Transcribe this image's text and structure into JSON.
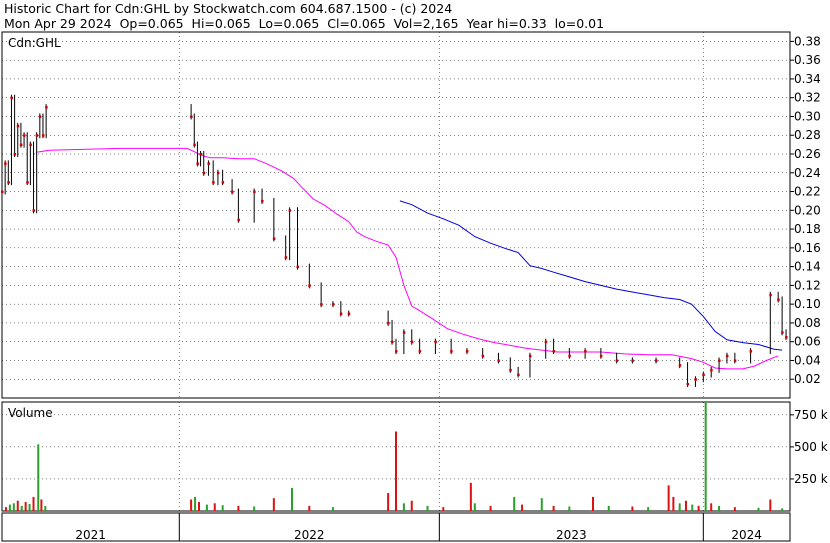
{
  "header": {
    "line1": "Historic Chart for Cdn:GHL by Stockwatch.com 604.687.1500 - (c) 2024",
    "line2": "Mon Apr 29 2024  Op=0.065  Hi=0.065  Lo=0.065  Cl=0.065  Vol=2,165  Year hi=0.33  lo=0.01"
  },
  "chart_data": [
    {
      "type": "line",
      "title": "Cdn:GHL",
      "ylim": [
        0.0,
        0.39
      ],
      "ytick_labels": [
        "0.38",
        "0.36",
        "0.34",
        "0.32",
        "0.30",
        "0.28",
        "0.26",
        "0.24",
        "0.22",
        "0.20",
        "0.18",
        "0.16",
        "0.14",
        "0.12",
        "0.10",
        "0.08",
        "0.06",
        "0.04",
        "0.02"
      ],
      "yticks": [
        0.38,
        0.36,
        0.34,
        0.32,
        0.3,
        0.28,
        0.26,
        0.24,
        0.22,
        0.2,
        0.18,
        0.16,
        0.14,
        0.12,
        0.1,
        0.08,
        0.06,
        0.04,
        0.02
      ],
      "x_period_labels": [
        "2021",
        "2022",
        "2023",
        "2024"
      ],
      "x_period_bounds": [
        [
          0.0,
          0.225
        ],
        [
          0.225,
          0.555
        ],
        [
          0.555,
          0.89
        ],
        [
          0.89,
          1.0
        ]
      ],
      "grid": true,
      "colors": {
        "price": "#000000",
        "close_dot": "#cc0000",
        "ma_short": "#ff00ff",
        "ma_long": "#0000dd"
      },
      "series": [
        {
          "kind": "ma_short",
          "points": [
            [
              0.045,
              0.262
            ],
            [
              0.06,
              0.264
            ],
            [
              0.15,
              0.266
            ],
            [
              0.235,
              0.266
            ],
            [
              0.245,
              0.262
            ],
            [
              0.255,
              0.258
            ],
            [
              0.265,
              0.256
            ],
            [
              0.28,
              0.256
            ],
            [
              0.3,
              0.255
            ],
            [
              0.32,
              0.255
            ],
            [
              0.335,
              0.25
            ],
            [
              0.355,
              0.242
            ],
            [
              0.37,
              0.234
            ],
            [
              0.38,
              0.225
            ],
            [
              0.395,
              0.212
            ],
            [
              0.41,
              0.205
            ],
            [
              0.425,
              0.196
            ],
            [
              0.44,
              0.188
            ],
            [
              0.45,
              0.177
            ],
            [
              0.46,
              0.172
            ],
            [
              0.475,
              0.167
            ],
            [
              0.49,
              0.163
            ],
            [
              0.5,
              0.15
            ],
            [
              0.51,
              0.12
            ],
            [
              0.52,
              0.098
            ],
            [
              0.53,
              0.093
            ],
            [
              0.545,
              0.085
            ],
            [
              0.565,
              0.074
            ],
            [
              0.585,
              0.068
            ],
            [
              0.605,
              0.063
            ],
            [
              0.625,
              0.059
            ],
            [
              0.645,
              0.056
            ],
            [
              0.665,
              0.053
            ],
            [
              0.685,
              0.051
            ],
            [
              0.705,
              0.049
            ],
            [
              0.73,
              0.049
            ],
            [
              0.76,
              0.049
            ],
            [
              0.79,
              0.047
            ],
            [
              0.82,
              0.046
            ],
            [
              0.85,
              0.046
            ],
            [
              0.875,
              0.042
            ],
            [
              0.89,
              0.038
            ],
            [
              0.905,
              0.032
            ],
            [
              0.92,
              0.031
            ],
            [
              0.94,
              0.031
            ],
            [
              0.955,
              0.034
            ],
            [
              0.97,
              0.04
            ],
            [
              0.985,
              0.045
            ]
          ]
        },
        {
          "kind": "ma_long",
          "points": [
            [
              0.505,
              0.21
            ],
            [
              0.52,
              0.206
            ],
            [
              0.54,
              0.197
            ],
            [
              0.56,
              0.191
            ],
            [
              0.58,
              0.184
            ],
            [
              0.6,
              0.172
            ],
            [
              0.62,
              0.165
            ],
            [
              0.64,
              0.159
            ],
            [
              0.655,
              0.155
            ],
            [
              0.67,
              0.141
            ],
            [
              0.685,
              0.138
            ],
            [
              0.7,
              0.134
            ],
            [
              0.72,
              0.129
            ],
            [
              0.74,
              0.124
            ],
            [
              0.76,
              0.12
            ],
            [
              0.78,
              0.116
            ],
            [
              0.8,
              0.113
            ],
            [
              0.82,
              0.11
            ],
            [
              0.84,
              0.107
            ],
            [
              0.86,
              0.105
            ],
            [
              0.875,
              0.1
            ],
            [
              0.89,
              0.087
            ],
            [
              0.905,
              0.071
            ],
            [
              0.92,
              0.062
            ],
            [
              0.94,
              0.059
            ],
            [
              0.96,
              0.057
            ],
            [
              0.98,
              0.052
            ],
            [
              0.99,
              0.051
            ]
          ]
        },
        {
          "kind": "price",
          "points": [
            [
              0.0,
              0.22
            ],
            [
              0.004,
              0.25
            ],
            [
              0.008,
              0.23
            ],
            [
              0.012,
              0.32
            ],
            [
              0.016,
              0.26
            ],
            [
              0.02,
              0.29
            ],
            [
              0.024,
              0.27
            ],
            [
              0.028,
              0.28
            ],
            [
              0.032,
              0.23
            ],
            [
              0.036,
              0.27
            ],
            [
              0.04,
              0.2
            ],
            [
              0.044,
              0.28
            ],
            [
              0.048,
              0.3
            ],
            [
              0.052,
              0.28
            ],
            [
              0.056,
              0.31
            ],
            [
              0.24,
              0.3
            ],
            [
              0.244,
              0.27
            ],
            [
              0.248,
              0.25
            ],
            [
              0.252,
              0.26
            ],
            [
              0.256,
              0.24
            ],
            [
              0.262,
              0.25
            ],
            [
              0.268,
              0.23
            ],
            [
              0.274,
              0.24
            ],
            [
              0.28,
              0.23
            ],
            [
              0.292,
              0.22
            ],
            [
              0.3,
              0.19
            ],
            [
              0.32,
              0.22
            ],
            [
              0.33,
              0.21
            ],
            [
              0.345,
              0.17
            ],
            [
              0.36,
              0.15
            ],
            [
              0.365,
              0.2
            ],
            [
              0.375,
              0.14
            ],
            [
              0.39,
              0.12
            ],
            [
              0.405,
              0.1
            ],
            [
              0.42,
              0.1
            ],
            [
              0.43,
              0.09
            ],
            [
              0.44,
              0.09
            ],
            [
              0.49,
              0.08
            ],
            [
              0.495,
              0.06
            ],
            [
              0.5,
              0.05
            ],
            [
              0.51,
              0.07
            ],
            [
              0.52,
              0.06
            ],
            [
              0.53,
              0.05
            ],
            [
              0.55,
              0.06
            ],
            [
              0.57,
              0.05
            ],
            [
              0.59,
              0.05
            ],
            [
              0.61,
              0.045
            ],
            [
              0.63,
              0.04
            ],
            [
              0.645,
              0.03
            ],
            [
              0.655,
              0.025
            ],
            [
              0.67,
              0.045
            ],
            [
              0.69,
              0.06
            ],
            [
              0.7,
              0.05
            ],
            [
              0.72,
              0.045
            ],
            [
              0.74,
              0.05
            ],
            [
              0.76,
              0.045
            ],
            [
              0.78,
              0.04
            ],
            [
              0.8,
              0.04
            ],
            [
              0.83,
              0.04
            ],
            [
              0.86,
              0.035
            ],
            [
              0.87,
              0.015
            ],
            [
              0.88,
              0.02
            ],
            [
              0.89,
              0.025
            ],
            [
              0.9,
              0.03
            ],
            [
              0.91,
              0.04
            ],
            [
              0.92,
              0.045
            ],
            [
              0.93,
              0.04
            ],
            [
              0.95,
              0.05
            ],
            [
              0.975,
              0.11
            ],
            [
              0.985,
              0.105
            ],
            [
              0.99,
              0.07
            ],
            [
              0.995,
              0.065
            ]
          ]
        }
      ]
    },
    {
      "type": "bar",
      "title": "Volume",
      "ylim": [
        0,
        850000
      ],
      "ytick_labels": [
        "750 k",
        "500 k",
        "250 k"
      ],
      "yticks": [
        750000,
        500000,
        250000
      ],
      "colors": {
        "up": "#2aa02a",
        "down": "#dd1111"
      },
      "bars": [
        {
          "x": 0.005,
          "v": 30000,
          "c": "down"
        },
        {
          "x": 0.01,
          "v": 50000,
          "c": "up"
        },
        {
          "x": 0.015,
          "v": 60000,
          "c": "up"
        },
        {
          "x": 0.02,
          "v": 80000,
          "c": "down"
        },
        {
          "x": 0.025,
          "v": 40000,
          "c": "up"
        },
        {
          "x": 0.03,
          "v": 70000,
          "c": "down"
        },
        {
          "x": 0.035,
          "v": 55000,
          "c": "up"
        },
        {
          "x": 0.04,
          "v": 110000,
          "c": "down"
        },
        {
          "x": 0.046,
          "v": 520000,
          "c": "up"
        },
        {
          "x": 0.05,
          "v": 90000,
          "c": "down"
        },
        {
          "x": 0.055,
          "v": 40000,
          "c": "up"
        },
        {
          "x": 0.24,
          "v": 90000,
          "c": "down"
        },
        {
          "x": 0.245,
          "v": 110000,
          "c": "up"
        },
        {
          "x": 0.25,
          "v": 70000,
          "c": "down"
        },
        {
          "x": 0.26,
          "v": 50000,
          "c": "up"
        },
        {
          "x": 0.27,
          "v": 60000,
          "c": "down"
        },
        {
          "x": 0.28,
          "v": 45000,
          "c": "up"
        },
        {
          "x": 0.3,
          "v": 40000,
          "c": "down"
        },
        {
          "x": 0.32,
          "v": 35000,
          "c": "up"
        },
        {
          "x": 0.345,
          "v": 100000,
          "c": "down"
        },
        {
          "x": 0.368,
          "v": 180000,
          "c": "up"
        },
        {
          "x": 0.39,
          "v": 40000,
          "c": "down"
        },
        {
          "x": 0.42,
          "v": 30000,
          "c": "up"
        },
        {
          "x": 0.49,
          "v": 140000,
          "c": "down"
        },
        {
          "x": 0.5,
          "v": 620000,
          "c": "down"
        },
        {
          "x": 0.51,
          "v": 60000,
          "c": "up"
        },
        {
          "x": 0.52,
          "v": 80000,
          "c": "down"
        },
        {
          "x": 0.54,
          "v": 40000,
          "c": "up"
        },
        {
          "x": 0.56,
          "v": 30000,
          "c": "down"
        },
        {
          "x": 0.595,
          "v": 220000,
          "c": "down"
        },
        {
          "x": 0.6,
          "v": 60000,
          "c": "up"
        },
        {
          "x": 0.62,
          "v": 40000,
          "c": "down"
        },
        {
          "x": 0.65,
          "v": 110000,
          "c": "up"
        },
        {
          "x": 0.66,
          "v": 50000,
          "c": "down"
        },
        {
          "x": 0.685,
          "v": 100000,
          "c": "up"
        },
        {
          "x": 0.7,
          "v": 40000,
          "c": "down"
        },
        {
          "x": 0.72,
          "v": 35000,
          "c": "up"
        },
        {
          "x": 0.75,
          "v": 110000,
          "c": "down"
        },
        {
          "x": 0.77,
          "v": 40000,
          "c": "up"
        },
        {
          "x": 0.8,
          "v": 35000,
          "c": "down"
        },
        {
          "x": 0.82,
          "v": 30000,
          "c": "up"
        },
        {
          "x": 0.846,
          "v": 200000,
          "c": "down"
        },
        {
          "x": 0.852,
          "v": 110000,
          "c": "down"
        },
        {
          "x": 0.86,
          "v": 60000,
          "c": "up"
        },
        {
          "x": 0.868,
          "v": 80000,
          "c": "down"
        },
        {
          "x": 0.876,
          "v": 50000,
          "c": "up"
        },
        {
          "x": 0.884,
          "v": 40000,
          "c": "down"
        },
        {
          "x": 0.893,
          "v": 850000,
          "c": "up"
        },
        {
          "x": 0.9,
          "v": 60000,
          "c": "down"
        },
        {
          "x": 0.91,
          "v": 40000,
          "c": "up"
        },
        {
          "x": 0.93,
          "v": 30000,
          "c": "down"
        },
        {
          "x": 0.96,
          "v": 25000,
          "c": "up"
        },
        {
          "x": 0.975,
          "v": 90000,
          "c": "down"
        },
        {
          "x": 0.99,
          "v": 20000,
          "c": "up"
        }
      ]
    }
  ]
}
